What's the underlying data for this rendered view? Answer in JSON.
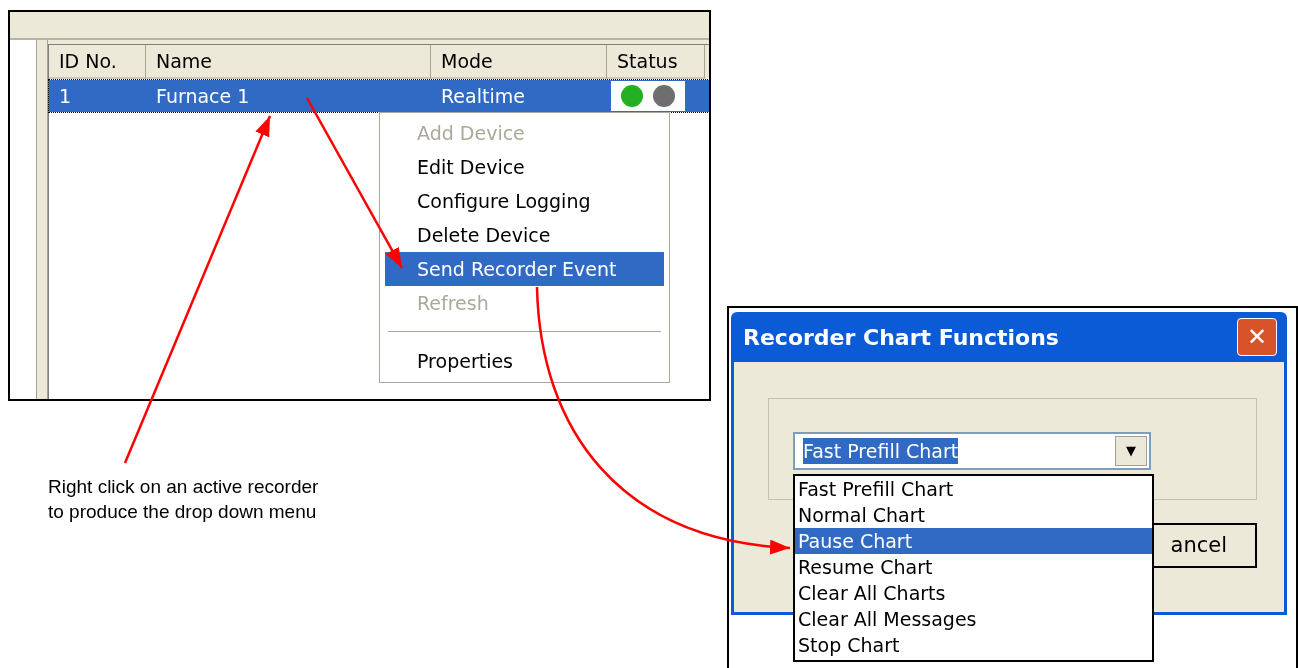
{
  "device_list": {
    "columns": [
      "ID No.",
      "Name",
      "Mode",
      "Status"
    ],
    "rows": [
      {
        "id": "1",
        "name": "Furnace 1",
        "mode": "Realtime",
        "selected": true,
        "status": [
          {
            "color": "#22b022"
          },
          {
            "color": "#6e6e6e"
          }
        ]
      }
    ]
  },
  "context_menu": {
    "items": [
      {
        "kind": "item",
        "label": "Add Device",
        "disabled": true,
        "selected": false
      },
      {
        "kind": "item",
        "label": "Edit Device",
        "disabled": false,
        "selected": false
      },
      {
        "kind": "item",
        "label": "Configure Logging",
        "disabled": false,
        "selected": false
      },
      {
        "kind": "item",
        "label": "Delete Device",
        "disabled": false,
        "selected": false
      },
      {
        "kind": "item",
        "label": "Send Recorder Event",
        "disabled": false,
        "selected": true
      },
      {
        "kind": "item",
        "label": "Refresh",
        "disabled": true,
        "selected": false
      },
      {
        "kind": "separator"
      },
      {
        "kind": "item",
        "label": "Properties",
        "disabled": false,
        "selected": false
      }
    ]
  },
  "caption": "Right click on an active recorder\nto produce the drop down menu",
  "dialog": {
    "title": "Recorder Chart Functions",
    "close": "✕",
    "combo": {
      "value": "Fast Prefill Chart",
      "arrow": "▼"
    },
    "options": [
      {
        "label": "Fast Prefill Chart",
        "selected": false
      },
      {
        "label": "Normal Chart",
        "selected": false
      },
      {
        "label": "Pause Chart",
        "selected": true
      },
      {
        "label": "Resume Chart",
        "selected": false
      },
      {
        "label": "Clear All Charts",
        "selected": false
      },
      {
        "label": "Clear All Messages",
        "selected": false
      },
      {
        "label": "Stop Chart",
        "selected": false
      }
    ],
    "cancel_button": "ancel"
  }
}
